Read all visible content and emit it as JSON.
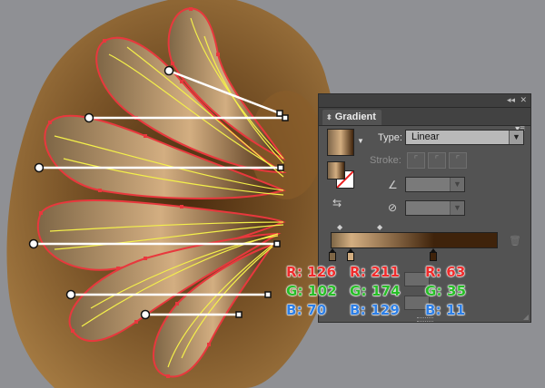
{
  "panel": {
    "title": "Gradient",
    "collapse_icon": "double-chevron-icon",
    "close_icon": "close-icon",
    "menu_icon": "panel-menu-icon",
    "type_label": "Type:",
    "type_value": "Linear",
    "stroke_label": "Stroke:",
    "trash_icon": "trash-icon"
  },
  "gradient": {
    "stops": [
      {
        "R": 126,
        "G": 102,
        "B": 70,
        "color": "#7e6646"
      },
      {
        "R": 211,
        "G": 174,
        "B": 129,
        "color": "#d3ae81"
      },
      {
        "R": 63,
        "G": 35,
        "B": 11,
        "color": "#3f230b"
      }
    ]
  },
  "labels": {
    "r": "R:",
    "g": "G:",
    "b": "B:"
  },
  "colors": {
    "canvas_bg": "#8f9094",
    "panel_bg": "#535353",
    "red_text": "#ef2c2c",
    "green_text": "#27bd27",
    "blue_text": "#2d7fe6",
    "path_red": "#e8383d",
    "path_yellow": "#f4f04a"
  }
}
